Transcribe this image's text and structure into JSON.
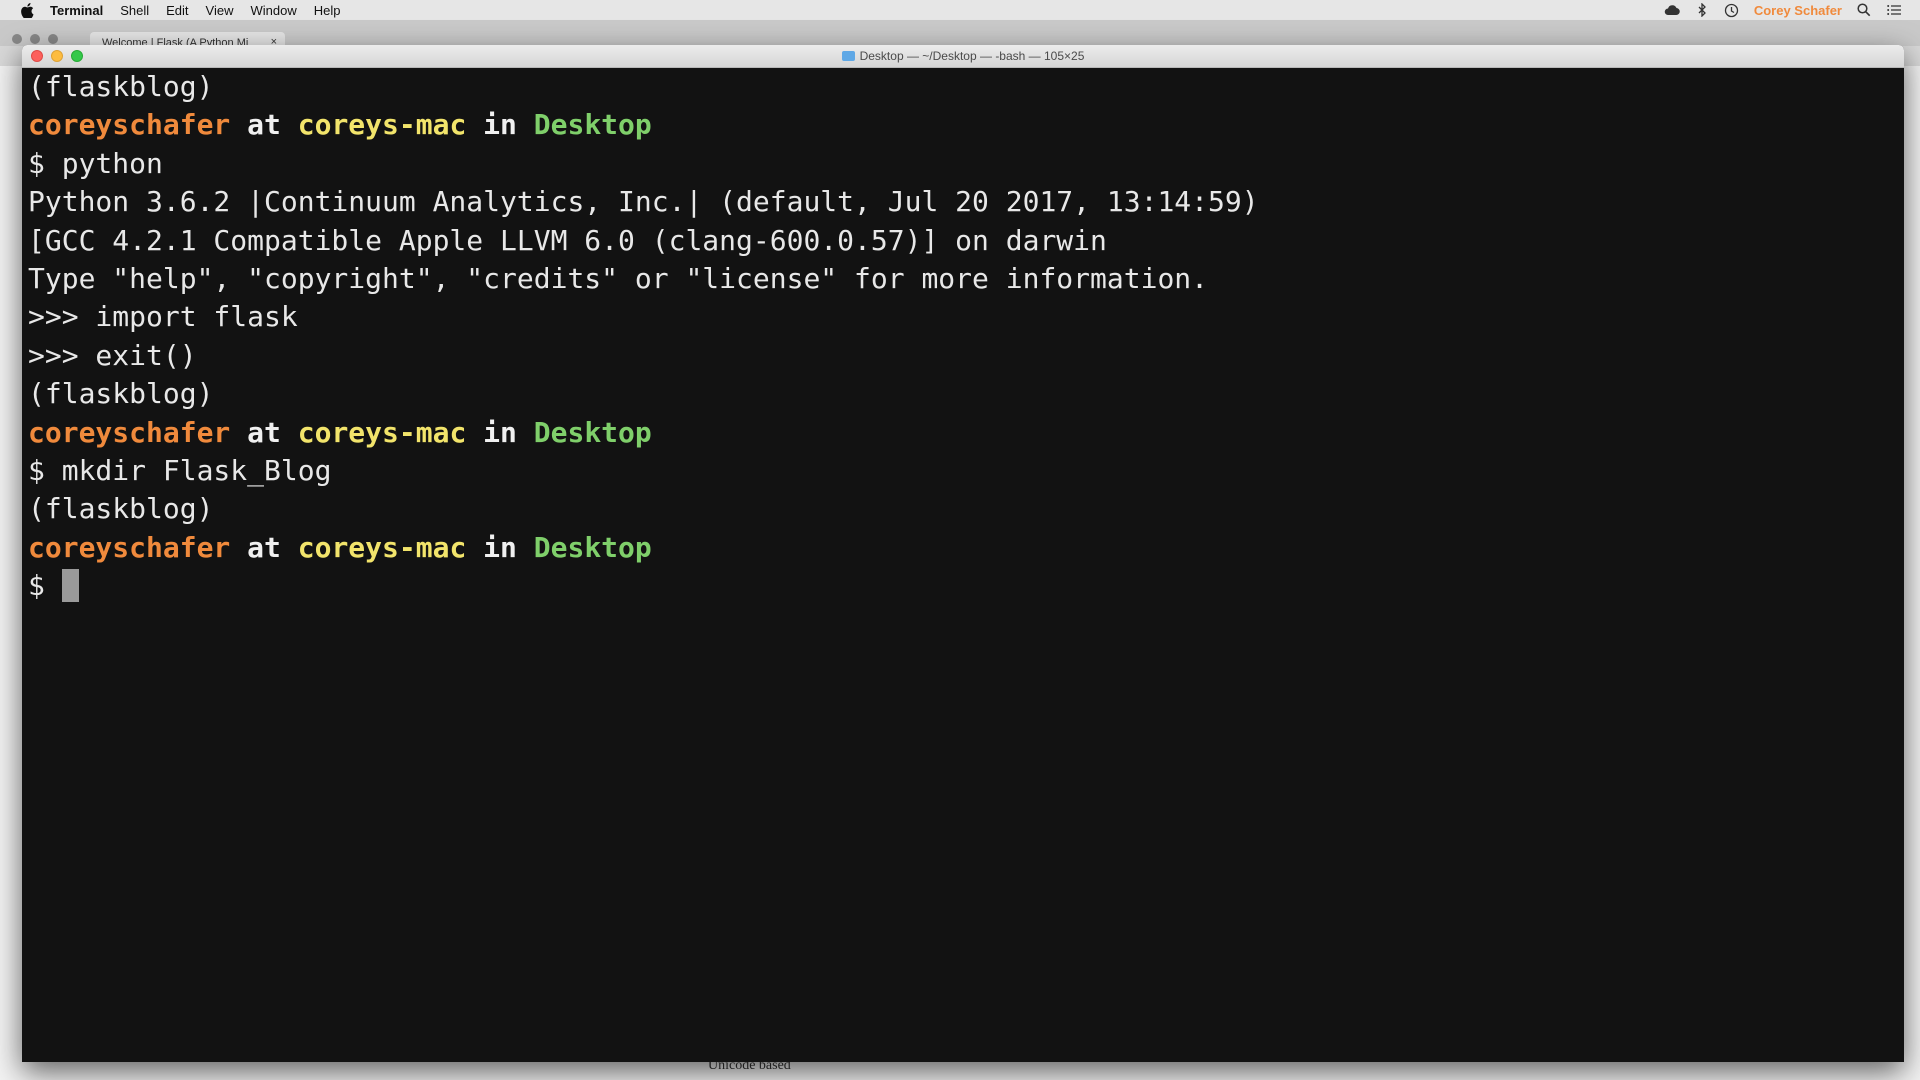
{
  "menubar": {
    "app_name": "Terminal",
    "items": [
      "Shell",
      "Edit",
      "View",
      "Window",
      "Help"
    ],
    "user_name": "Corey Schafer",
    "status_icons": [
      "creative-cloud-icon",
      "bluetooth-icon",
      "time-machine-icon",
      "spotlight-icon",
      "notification-center-icon"
    ]
  },
  "browser": {
    "tab_title": "Welcome | Flask (A Python Mi",
    "tab_close": "×",
    "bottom_text": "Unicode based"
  },
  "terminal": {
    "title": "Desktop — ~/Desktop — -bash — 105×25",
    "lines": [
      {
        "type": "text",
        "text": "(flaskblog)"
      },
      {
        "type": "prompt",
        "user": "coreyschafer",
        "at": " at ",
        "host": "coreys-mac",
        "in": " in ",
        "dir": "Desktop"
      },
      {
        "type": "text",
        "text": "$ python"
      },
      {
        "type": "text",
        "text": "Python 3.6.2 |Continuum Analytics, Inc.| (default, Jul 20 2017, 13:14:59)"
      },
      {
        "type": "text",
        "text": "[GCC 4.2.1 Compatible Apple LLVM 6.0 (clang-600.0.57)] on darwin"
      },
      {
        "type": "text",
        "text": "Type \"help\", \"copyright\", \"credits\" or \"license\" for more information."
      },
      {
        "type": "text",
        "text": ">>> import flask"
      },
      {
        "type": "text",
        "text": ">>> exit()"
      },
      {
        "type": "text",
        "text": "(flaskblog)"
      },
      {
        "type": "prompt",
        "user": "coreyschafer",
        "at": " at ",
        "host": "coreys-mac",
        "in": " in ",
        "dir": "Desktop"
      },
      {
        "type": "text",
        "text": "$ mkdir Flask_Blog"
      },
      {
        "type": "text",
        "text": "(flaskblog)"
      },
      {
        "type": "prompt",
        "user": "coreyschafer",
        "at": " at ",
        "host": "coreys-mac",
        "in": " in ",
        "dir": "Desktop"
      },
      {
        "type": "input",
        "text": "$ "
      }
    ]
  },
  "colors": {
    "user": "#f08a3c",
    "host": "#f2e46b",
    "dir": "#7fcf6a",
    "text": "#e8e8e8",
    "background": "#121212"
  }
}
